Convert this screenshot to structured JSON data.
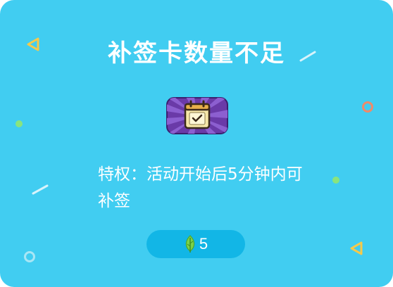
{
  "dialog": {
    "title": "补签卡数量不足",
    "description": "特权：活动开始后5分钟内可补签",
    "cost": {
      "icon": "leaf-icon",
      "amount": "5"
    },
    "badge_icon": "calendar-check-icon"
  },
  "colors": {
    "background": "#41cdf1",
    "button": "#12b6e6",
    "badge": "#6a3aa8",
    "leaf": "#7bd24a",
    "triangle_yellow": "#f6c94a",
    "dot_green": "#8ae47e",
    "ring_orange": "#ef8a6a"
  }
}
